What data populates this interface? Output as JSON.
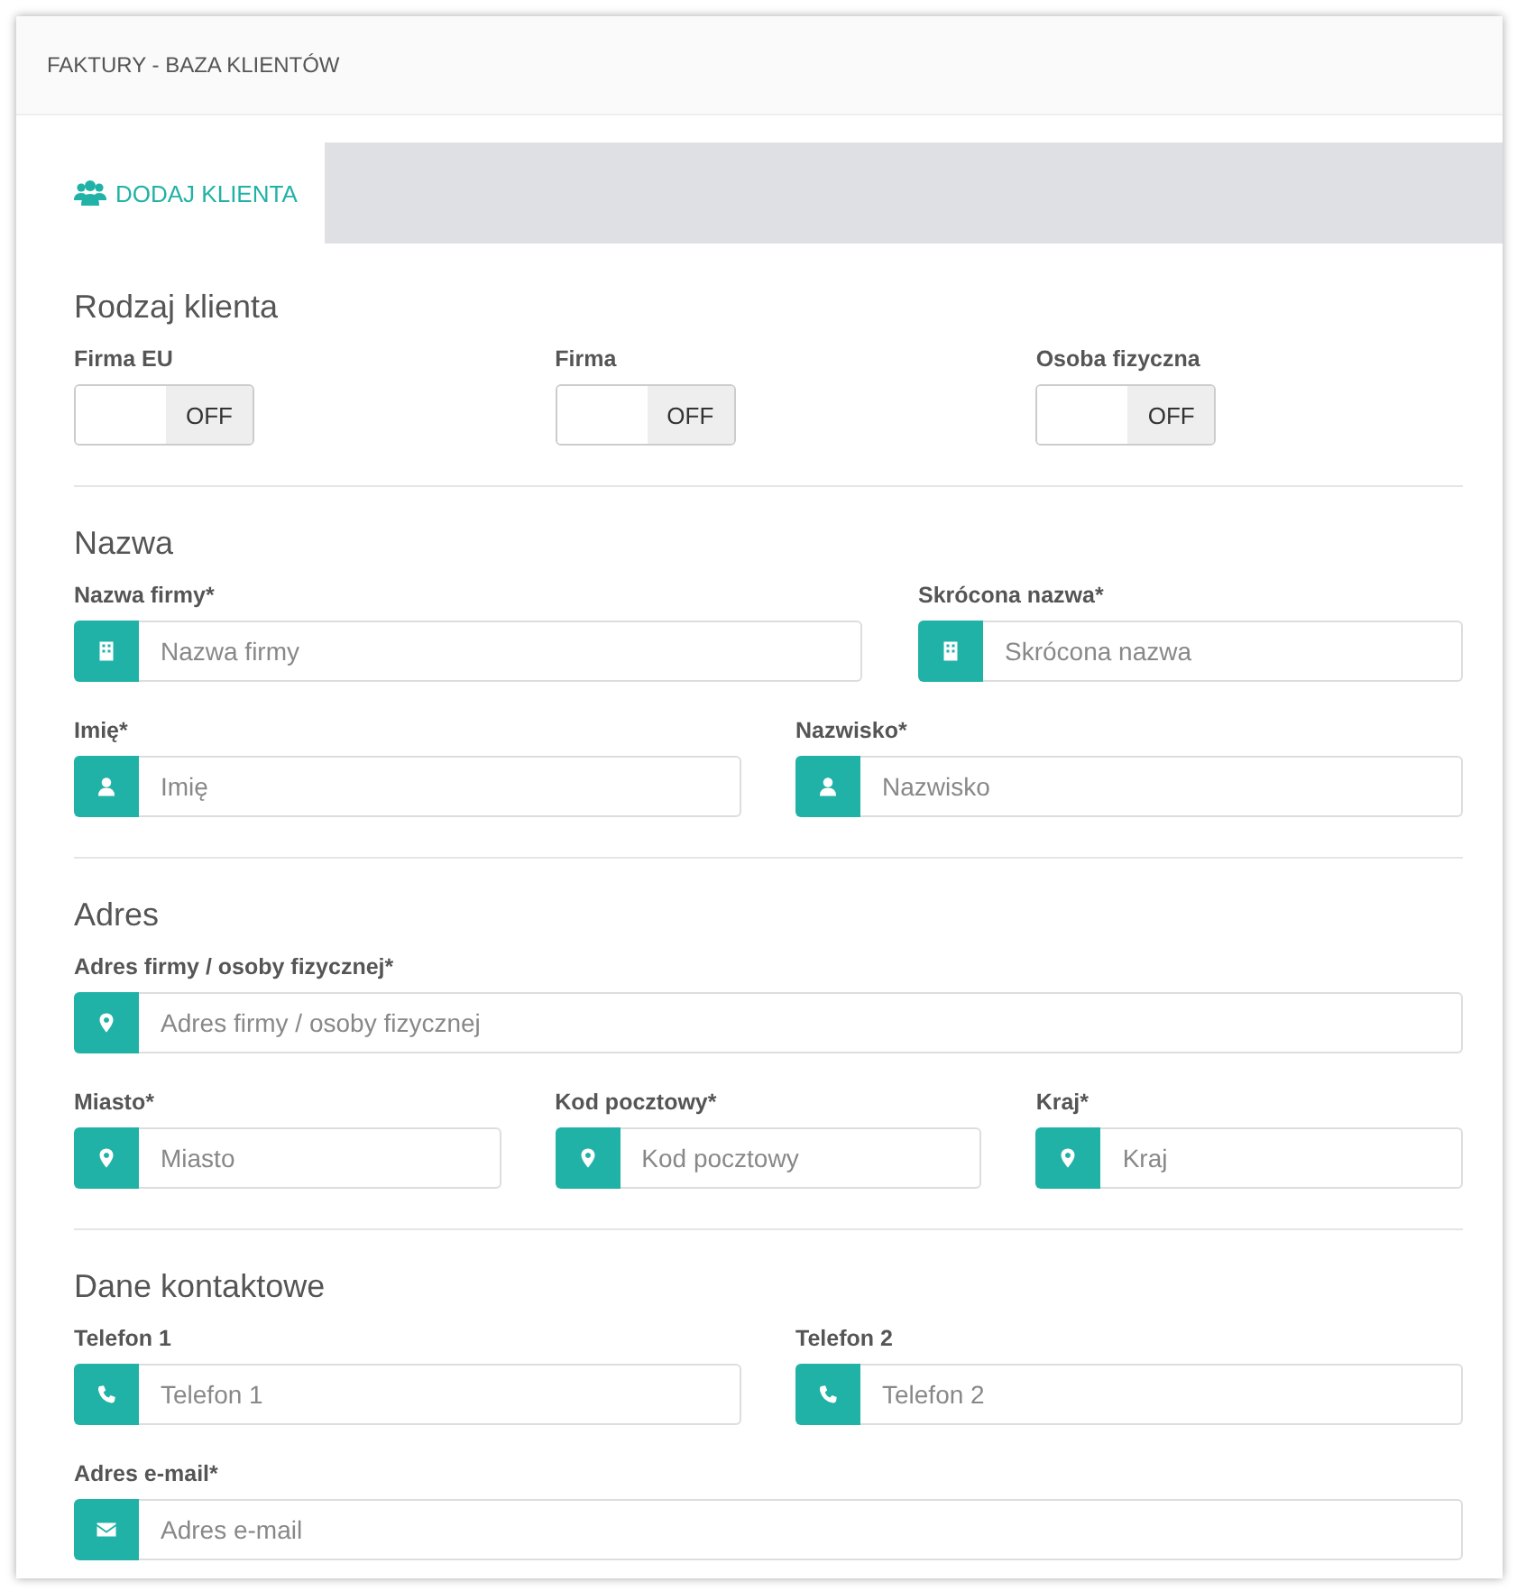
{
  "header": {
    "title": "FAKTURY - BAZA KLIENTÓW"
  },
  "tabs": [
    {
      "label": "DODAJ KLIENTA",
      "selected": true
    }
  ],
  "sections": [
    {
      "title": "Rodzaj klienta",
      "kind": "toggles",
      "toggles": [
        {
          "label": "Firma EU",
          "on": false,
          "state_label": "OFF"
        },
        {
          "label": "Firma",
          "on": false,
          "state_label": "OFF"
        },
        {
          "label": "Osoba fizyczna",
          "on": false,
          "state_label": "OFF"
        }
      ]
    },
    {
      "title": "Nazwa",
      "kind": "fields",
      "rows": [
        [
          {
            "label": "Nazwa firmy*",
            "placeholder": "Nazwa firmy",
            "kind": "building"
          },
          {
            "label": "Skrócona nazwa*",
            "placeholder": "Skrócona nazwa",
            "kind": "building"
          }
        ],
        [
          {
            "label": "Imię*",
            "placeholder": "Imię",
            "kind": "user"
          },
          {
            "label": "Nazwisko*",
            "placeholder": "Nazwisko",
            "kind": "user"
          }
        ]
      ]
    },
    {
      "title": "Adres",
      "kind": "fields",
      "rows": [
        [
          {
            "label": "Adres firmy / osoby fizycznej*",
            "placeholder": "Adres firmy / osoby fizycznej",
            "kind": "location"
          }
        ],
        [
          {
            "label": "Miasto*",
            "placeholder": "Miasto",
            "kind": "location"
          },
          {
            "label": "Kod pocztowy*",
            "placeholder": "Kod pocztowy",
            "kind": "location"
          },
          {
            "label": "Kraj*",
            "placeholder": "Kraj",
            "kind": "location"
          }
        ]
      ]
    },
    {
      "title": "Dane kontaktowe",
      "kind": "fields",
      "rows": [
        [
          {
            "label": "Telefon 1",
            "placeholder": "Telefon 1",
            "kind": "phone"
          },
          {
            "label": "Telefon 2",
            "placeholder": "Telefon 2",
            "kind": "phone"
          }
        ],
        [
          {
            "label": "Adres e-mail*",
            "placeholder": "Adres e-mail",
            "kind": "email"
          }
        ]
      ]
    }
  ]
}
